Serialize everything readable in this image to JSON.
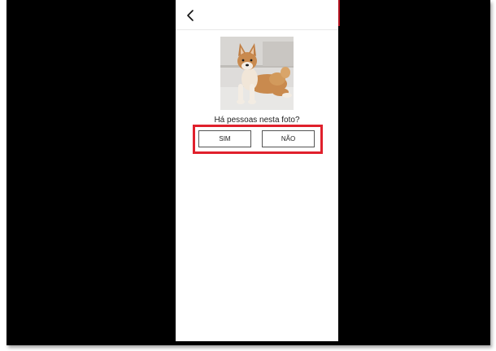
{
  "question": {
    "text": "Há pessoas nesta foto?"
  },
  "buttons": {
    "yes_label": "SIM",
    "no_label": "NÃO"
  },
  "icons": {
    "back": "back-arrow-icon"
  },
  "colors": {
    "highlight": "#e0202c",
    "backdrop": "#000000",
    "screen": "#ffffff"
  }
}
